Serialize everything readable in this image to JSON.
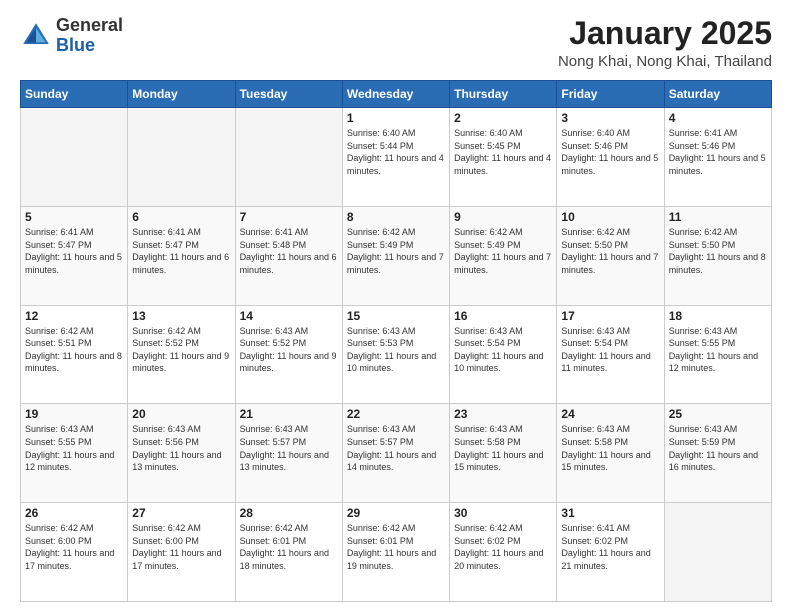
{
  "header": {
    "logo_general": "General",
    "logo_blue": "Blue",
    "month_title": "January 2025",
    "location": "Nong Khai, Nong Khai, Thailand"
  },
  "days_of_week": [
    "Sunday",
    "Monday",
    "Tuesday",
    "Wednesday",
    "Thursday",
    "Friday",
    "Saturday"
  ],
  "weeks": [
    [
      {
        "day": "",
        "info": ""
      },
      {
        "day": "",
        "info": ""
      },
      {
        "day": "",
        "info": ""
      },
      {
        "day": "1",
        "info": "Sunrise: 6:40 AM\nSunset: 5:44 PM\nDaylight: 11 hours and 4 minutes."
      },
      {
        "day": "2",
        "info": "Sunrise: 6:40 AM\nSunset: 5:45 PM\nDaylight: 11 hours and 4 minutes."
      },
      {
        "day": "3",
        "info": "Sunrise: 6:40 AM\nSunset: 5:46 PM\nDaylight: 11 hours and 5 minutes."
      },
      {
        "day": "4",
        "info": "Sunrise: 6:41 AM\nSunset: 5:46 PM\nDaylight: 11 hours and 5 minutes."
      }
    ],
    [
      {
        "day": "5",
        "info": "Sunrise: 6:41 AM\nSunset: 5:47 PM\nDaylight: 11 hours and 5 minutes."
      },
      {
        "day": "6",
        "info": "Sunrise: 6:41 AM\nSunset: 5:47 PM\nDaylight: 11 hours and 6 minutes."
      },
      {
        "day": "7",
        "info": "Sunrise: 6:41 AM\nSunset: 5:48 PM\nDaylight: 11 hours and 6 minutes."
      },
      {
        "day": "8",
        "info": "Sunrise: 6:42 AM\nSunset: 5:49 PM\nDaylight: 11 hours and 7 minutes."
      },
      {
        "day": "9",
        "info": "Sunrise: 6:42 AM\nSunset: 5:49 PM\nDaylight: 11 hours and 7 minutes."
      },
      {
        "day": "10",
        "info": "Sunrise: 6:42 AM\nSunset: 5:50 PM\nDaylight: 11 hours and 7 minutes."
      },
      {
        "day": "11",
        "info": "Sunrise: 6:42 AM\nSunset: 5:50 PM\nDaylight: 11 hours and 8 minutes."
      }
    ],
    [
      {
        "day": "12",
        "info": "Sunrise: 6:42 AM\nSunset: 5:51 PM\nDaylight: 11 hours and 8 minutes."
      },
      {
        "day": "13",
        "info": "Sunrise: 6:42 AM\nSunset: 5:52 PM\nDaylight: 11 hours and 9 minutes."
      },
      {
        "day": "14",
        "info": "Sunrise: 6:43 AM\nSunset: 5:52 PM\nDaylight: 11 hours and 9 minutes."
      },
      {
        "day": "15",
        "info": "Sunrise: 6:43 AM\nSunset: 5:53 PM\nDaylight: 11 hours and 10 minutes."
      },
      {
        "day": "16",
        "info": "Sunrise: 6:43 AM\nSunset: 5:54 PM\nDaylight: 11 hours and 10 minutes."
      },
      {
        "day": "17",
        "info": "Sunrise: 6:43 AM\nSunset: 5:54 PM\nDaylight: 11 hours and 11 minutes."
      },
      {
        "day": "18",
        "info": "Sunrise: 6:43 AM\nSunset: 5:55 PM\nDaylight: 11 hours and 12 minutes."
      }
    ],
    [
      {
        "day": "19",
        "info": "Sunrise: 6:43 AM\nSunset: 5:55 PM\nDaylight: 11 hours and 12 minutes."
      },
      {
        "day": "20",
        "info": "Sunrise: 6:43 AM\nSunset: 5:56 PM\nDaylight: 11 hours and 13 minutes."
      },
      {
        "day": "21",
        "info": "Sunrise: 6:43 AM\nSunset: 5:57 PM\nDaylight: 11 hours and 13 minutes."
      },
      {
        "day": "22",
        "info": "Sunrise: 6:43 AM\nSunset: 5:57 PM\nDaylight: 11 hours and 14 minutes."
      },
      {
        "day": "23",
        "info": "Sunrise: 6:43 AM\nSunset: 5:58 PM\nDaylight: 11 hours and 15 minutes."
      },
      {
        "day": "24",
        "info": "Sunrise: 6:43 AM\nSunset: 5:58 PM\nDaylight: 11 hours and 15 minutes."
      },
      {
        "day": "25",
        "info": "Sunrise: 6:43 AM\nSunset: 5:59 PM\nDaylight: 11 hours and 16 minutes."
      }
    ],
    [
      {
        "day": "26",
        "info": "Sunrise: 6:42 AM\nSunset: 6:00 PM\nDaylight: 11 hours and 17 minutes."
      },
      {
        "day": "27",
        "info": "Sunrise: 6:42 AM\nSunset: 6:00 PM\nDaylight: 11 hours and 17 minutes."
      },
      {
        "day": "28",
        "info": "Sunrise: 6:42 AM\nSunset: 6:01 PM\nDaylight: 11 hours and 18 minutes."
      },
      {
        "day": "29",
        "info": "Sunrise: 6:42 AM\nSunset: 6:01 PM\nDaylight: 11 hours and 19 minutes."
      },
      {
        "day": "30",
        "info": "Sunrise: 6:42 AM\nSunset: 6:02 PM\nDaylight: 11 hours and 20 minutes."
      },
      {
        "day": "31",
        "info": "Sunrise: 6:41 AM\nSunset: 6:02 PM\nDaylight: 11 hours and 21 minutes."
      },
      {
        "day": "",
        "info": ""
      }
    ]
  ]
}
